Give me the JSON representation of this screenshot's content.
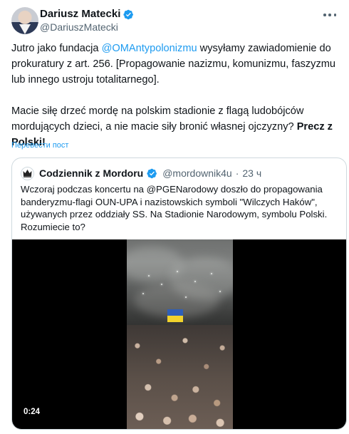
{
  "tweet": {
    "author_name": "Dariusz Matecki",
    "author_handle": "@DariuszMatecki",
    "text_p1_before": "Jutro jako fundacja ",
    "text_p1_mention": "@OMAntypolonizmu",
    "text_p1_after": " wysyłamy zawiadomienie do prokuratury z art. 256. [Propagowanie nazizmu, komunizmu, faszyzmu lub innego ustroju totalitarnego].",
    "text_p2_before": "Macie siłę drzeć mordę na polskim stadionie z flagą ludobójców mordujących dzieci, a nie macie siły bronić własnej ojczyzny? ",
    "text_p2_bold": "Precz z Polski!",
    "translate_label": "Перевести пост"
  },
  "quote": {
    "author_name": "Codziennik z Mordoru",
    "author_handle": "@mordownik4u",
    "separator": "·",
    "time": "23 ч",
    "text": "Wczoraj podczas koncertu na @PGENarodowy doszło do propagowania banderyzmu-flagi OUN-UPA i nazistowskich symboli \"Wilczych Haków\", używanych przez oddziały SS. Na Stadionie Narodowym, symbolu Polski. Rozumiecie to?",
    "video_duration": "0:24"
  },
  "icons": {
    "verified": "verified-badge-icon",
    "more": "more-options-icon",
    "quote_avatar": "crown-logo-icon"
  },
  "colors": {
    "accent": "#1d9bf0",
    "text": "#0f1419",
    "secondary": "#536471",
    "border": "#cfd9de"
  }
}
